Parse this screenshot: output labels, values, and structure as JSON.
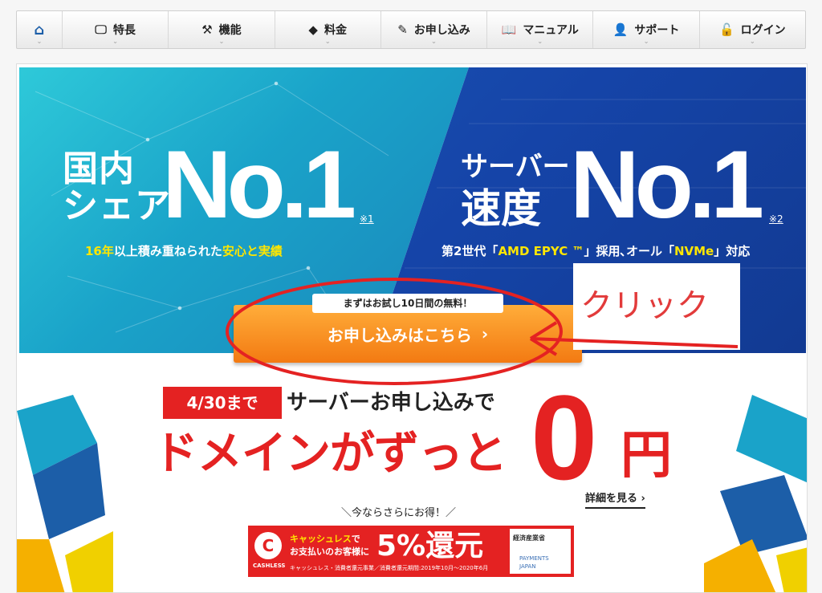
{
  "nav": {
    "items": [
      {
        "label": "",
        "icon": "home-icon"
      },
      {
        "label": "特長",
        "icon": "monitor-icon"
      },
      {
        "label": "機能",
        "icon": "tools-icon"
      },
      {
        "label": "料金",
        "icon": "tag-icon"
      },
      {
        "label": "お申し込み",
        "icon": "pencil-icon"
      },
      {
        "label": "マニュアル",
        "icon": "book-icon"
      },
      {
        "label": "サポート",
        "icon": "person-icon"
      },
      {
        "label": "ログイン",
        "icon": "lock-icon"
      }
    ]
  },
  "hero": {
    "left_heading": "国内\nシェア",
    "left_no1": "No.1",
    "left_note": "※1",
    "left_sub_yellow1": "16年",
    "left_sub_mid": "以上積み重ねられた",
    "left_sub_yellow2": "安心と実績",
    "right_heading_1": "サーバー",
    "right_heading_2": "速度",
    "right_no1": "No.1",
    "right_note": "※2",
    "right_sub_pre": "第2世代「",
    "right_sub_y1": "AMD EPYC ™",
    "right_sub_mid": "」採用､オール「",
    "right_sub_y2": "NVMe",
    "right_sub_post": "」対応"
  },
  "cta": {
    "trial_label": "まずはお試し10日間の無料！",
    "apply_label": "お申し込みはこちら",
    "chevron": "›"
  },
  "annotation": {
    "text": "クリック",
    "color": "#e23b3b"
  },
  "promo": {
    "badge": "4/30まで",
    "line1": "サーバーお申し込みで",
    "main": "ドメインがずっと",
    "zero": "0",
    "yen": "円",
    "detail": "詳細を見る",
    "detail_chevron": "›",
    "more": "＼今ならさらにお得！／"
  },
  "cashless": {
    "logo_mark": "C",
    "logo_sub": "CASHLESS",
    "t1_pre": "キャッシュレス",
    "t1_post": "で",
    "t2_pre": "お支払いの",
    "t2_post": "お客様に",
    "percent": "5%還元",
    "fine": "キャッシュレス・消費者還元事業／消費者還元期間:2019年10月〜2020年6月",
    "meti": "経済産業省",
    "pj_1": "PAYMENTS",
    "pj_2": "JAPAN"
  },
  "colors": {
    "accent_red": "#e42222",
    "cta_orange": "#f37a12",
    "hero_cyan": "#1aa3c9",
    "hero_blue": "#1544a8",
    "yellow": "#ffe600"
  }
}
